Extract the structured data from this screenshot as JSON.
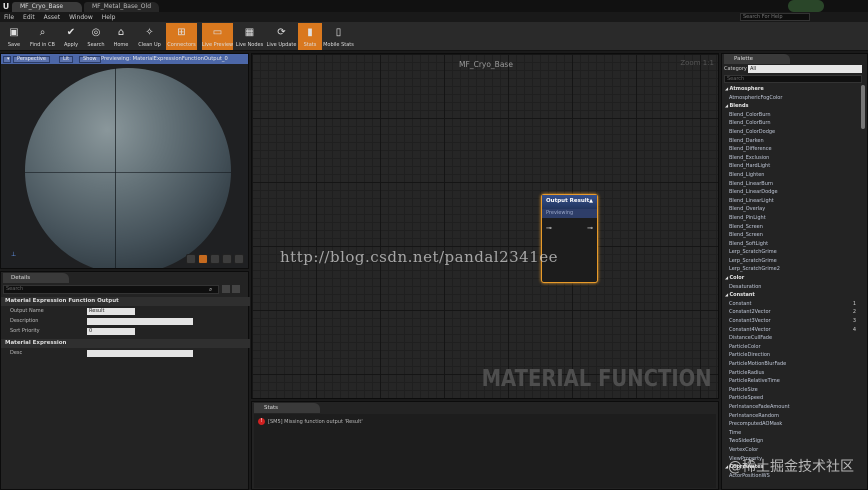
{
  "window": {
    "tabs": [
      "MF_Cryo_Base",
      "MF_Metal_Base_Old"
    ],
    "search_help_placeholder": "Search For Help"
  },
  "menu": [
    "File",
    "Edit",
    "Asset",
    "Window",
    "Help"
  ],
  "toolbar": [
    {
      "label": "Save",
      "icon": "save-icon"
    },
    {
      "label": "Find in CB",
      "icon": "folder-search-icon"
    },
    {
      "label": "Apply",
      "icon": "apply-icon"
    },
    {
      "label": "Search",
      "icon": "binoculars-icon"
    },
    {
      "label": "Home",
      "icon": "home-icon"
    },
    {
      "label": "Clean Up",
      "icon": "broom-icon"
    },
    {
      "label": "Connectors",
      "icon": "connectors-icon",
      "active": true
    },
    {
      "label": "Live Preview",
      "icon": "live-preview-icon",
      "active": true
    },
    {
      "label": "Live Nodes",
      "icon": "live-nodes-icon"
    },
    {
      "label": "Live Update",
      "icon": "live-update-icon"
    },
    {
      "label": "Stats",
      "icon": "stats-icon",
      "active": true
    },
    {
      "label": "Mobile Stats",
      "icon": "mobile-stats-icon"
    }
  ],
  "viewport": {
    "perspective_label": "Perspective",
    "lit_label": "Lit",
    "show_label": "Show",
    "path": "Previewing: MaterialExpressionFunctionOutput_0"
  },
  "details": {
    "tab": "Details",
    "search_placeholder": "Search",
    "section1": "Material Expression Function Output",
    "props": [
      {
        "label": "Output Name",
        "value": "Result"
      },
      {
        "label": "Description",
        "value": ""
      },
      {
        "label": "Sort Priority",
        "value": "0"
      }
    ],
    "section2": "Material Expression",
    "props2": [
      {
        "label": "Desc",
        "value": ""
      }
    ]
  },
  "graph": {
    "title": "MF_Cryo_Base",
    "zoom": "Zoom 1:1",
    "banner": "MATERIAL FUNCTION",
    "node_title": "Output Result",
    "node_sub": "Previewing"
  },
  "watermark": "http://blog.csdn.net/pandal2341ee",
  "watermark2": "@稀土掘金技术社区",
  "stats": {
    "tab": "Stats",
    "message": "[SM5] Missing function output 'Result'"
  },
  "palette": {
    "tab": "Palette",
    "category_label": "Category",
    "category_value": "All",
    "search_placeholder": "Search",
    "rows": [
      {
        "t": "Atmosphere",
        "cat": true
      },
      {
        "t": "AtmosphericFogColor"
      },
      {
        "t": "Blends",
        "cat": true
      },
      {
        "t": "Blend_ColorBurn"
      },
      {
        "t": "Blend_ColorBurn"
      },
      {
        "t": "Blend_ColorDodge"
      },
      {
        "t": "Blend_Darken"
      },
      {
        "t": "Blend_Difference"
      },
      {
        "t": "Blend_Exclusion"
      },
      {
        "t": "Blend_HardLight"
      },
      {
        "t": "Blend_Lighten"
      },
      {
        "t": "Blend_LinearBurn"
      },
      {
        "t": "Blend_LinearDodge"
      },
      {
        "t": "Blend_LinearLight"
      },
      {
        "t": "Blend_Overlay"
      },
      {
        "t": "Blend_PinLight"
      },
      {
        "t": "Blend_Screen"
      },
      {
        "t": "Blend_Screen"
      },
      {
        "t": "Blend_SoftLight"
      },
      {
        "t": "Lerp_ScratchGrime"
      },
      {
        "t": "Lerp_ScratchGrime"
      },
      {
        "t": "Lerp_ScratchGrime2"
      },
      {
        "t": "Color",
        "cat": true
      },
      {
        "t": "Desaturation"
      },
      {
        "t": "Constant",
        "cat": true
      },
      {
        "t": "Constant",
        "hk": "1"
      },
      {
        "t": "Constant2Vector",
        "hk": "2"
      },
      {
        "t": "Constant3Vector",
        "hk": "3"
      },
      {
        "t": "Constant4Vector",
        "hk": "4"
      },
      {
        "t": "DistanceCullFade"
      },
      {
        "t": "ParticleColor"
      },
      {
        "t": "ParticleDirection"
      },
      {
        "t": "ParticleMotionBlurFade"
      },
      {
        "t": "ParticleRadius"
      },
      {
        "t": "ParticleRelativeTime"
      },
      {
        "t": "ParticleSize"
      },
      {
        "t": "ParticleSpeed"
      },
      {
        "t": "PerInstanceFadeAmount"
      },
      {
        "t": "PerInstanceRandom"
      },
      {
        "t": "PrecomputedAOMask"
      },
      {
        "t": "Time"
      },
      {
        "t": "TwoSidedSign"
      },
      {
        "t": "VertexColor"
      },
      {
        "t": "ViewProperty"
      },
      {
        "t": "Coordinates",
        "cat": true
      },
      {
        "t": "ActorPositionWS"
      }
    ]
  }
}
